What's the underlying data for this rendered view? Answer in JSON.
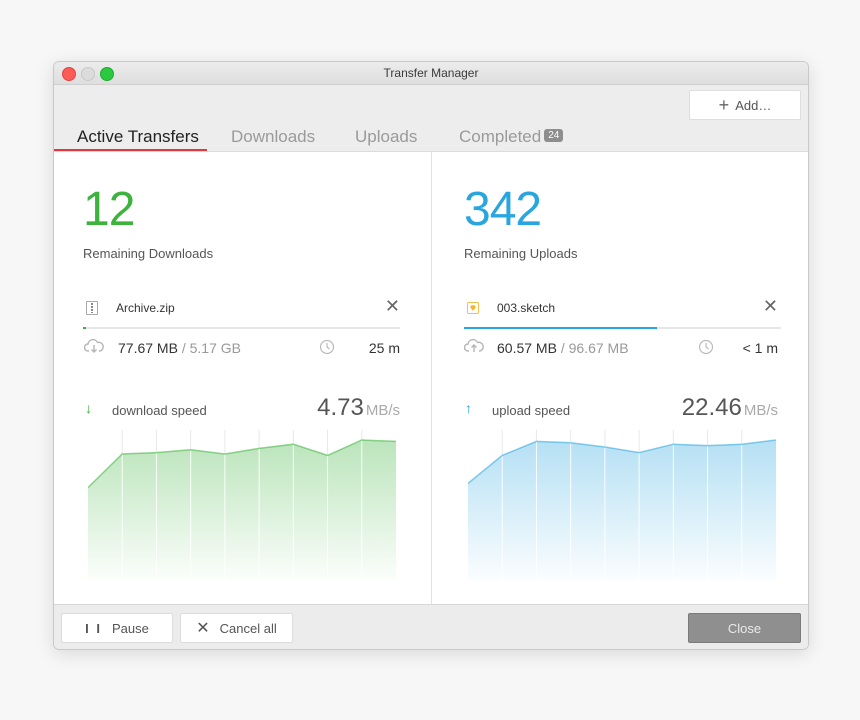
{
  "window": {
    "title": "Transfer Manager"
  },
  "header": {
    "add_button": {
      "icon": "plus-icon",
      "label": "Add…"
    },
    "tabs": [
      {
        "label": "Active Transfers",
        "active": true
      },
      {
        "label": "Downloads",
        "active": false
      },
      {
        "label": "Uploads",
        "active": false
      },
      {
        "label": "Completed",
        "active": false,
        "badge": "24"
      }
    ]
  },
  "downloads": {
    "count": "12",
    "count_label": "Remaining Downloads",
    "file": {
      "name": "Archive.zip",
      "icon": "zip-file-icon"
    },
    "progress_fraction": 0.01,
    "size_done": "77.67 MB",
    "size_total": "/ 5.17 GB",
    "time_remaining": "25 m",
    "speed_label": "download speed",
    "speed_value": "4.73",
    "speed_unit": "MB/s",
    "color": "#3cb33c"
  },
  "uploads": {
    "count": "342",
    "count_label": "Remaining Uploads",
    "file": {
      "name": "003.sketch",
      "icon": "sketch-file-icon"
    },
    "progress_fraction": 0.61,
    "size_done": "60.57 MB",
    "size_total": "/ 96.67 MB",
    "time_remaining": "< 1 m",
    "speed_label": "upload speed",
    "speed_value": "22.46",
    "speed_unit": "MB/s",
    "color": "#2aa6df"
  },
  "chart_data": [
    {
      "type": "area",
      "series": [
        {
          "values": [
            0.66,
            0.9,
            0.91,
            0.93,
            0.9,
            0.94,
            0.97,
            0.89,
            1.0,
            0.99
          ]
        }
      ],
      "ylim": [
        0,
        1
      ],
      "grid": true,
      "color": "#3cb33c"
    },
    {
      "type": "area",
      "series": [
        {
          "values": [
            0.69,
            0.89,
            0.99,
            0.98,
            0.95,
            0.91,
            0.97,
            0.96,
            0.97,
            1.0
          ]
        }
      ],
      "ylim": [
        0,
        1
      ],
      "grid": true,
      "color": "#2aa6df"
    }
  ],
  "footer": {
    "pause_label": "Pause",
    "cancel_label": "Cancel all",
    "close_label": "Close"
  }
}
